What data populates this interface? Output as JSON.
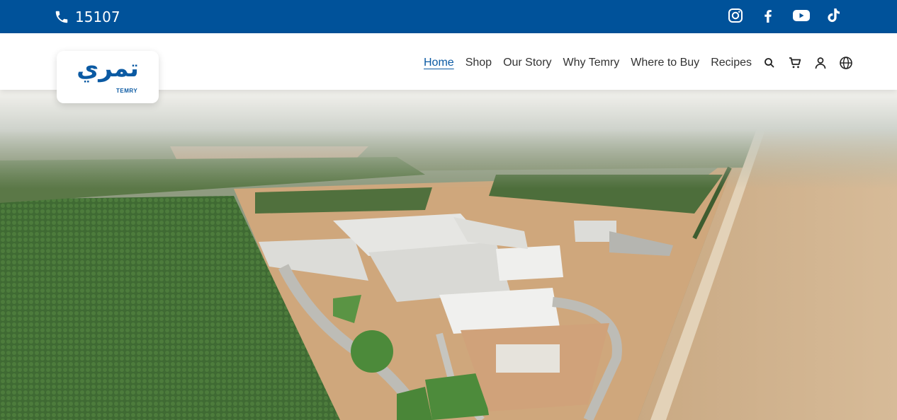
{
  "topbar": {
    "phone": "15107",
    "social": [
      "instagram-icon",
      "facebook-icon",
      "youtube-icon",
      "tiktok-icon"
    ],
    "background": "#00529a"
  },
  "logo": {
    "arabic": "تمري",
    "latin": "TEMRY"
  },
  "nav": {
    "items": [
      {
        "label": "Home",
        "active": true
      },
      {
        "label": "Shop",
        "active": false
      },
      {
        "label": "Our Story",
        "active": false
      },
      {
        "label": "Why Temry",
        "active": false
      },
      {
        "label": "Where to Buy",
        "active": false
      },
      {
        "label": "Recipes",
        "active": false
      }
    ],
    "icons": [
      "search-icon",
      "cart-icon",
      "user-icon",
      "globe-icon"
    ],
    "accent": "#0b5aa3"
  },
  "hero": {
    "image": "aerial-factory-photo"
  }
}
